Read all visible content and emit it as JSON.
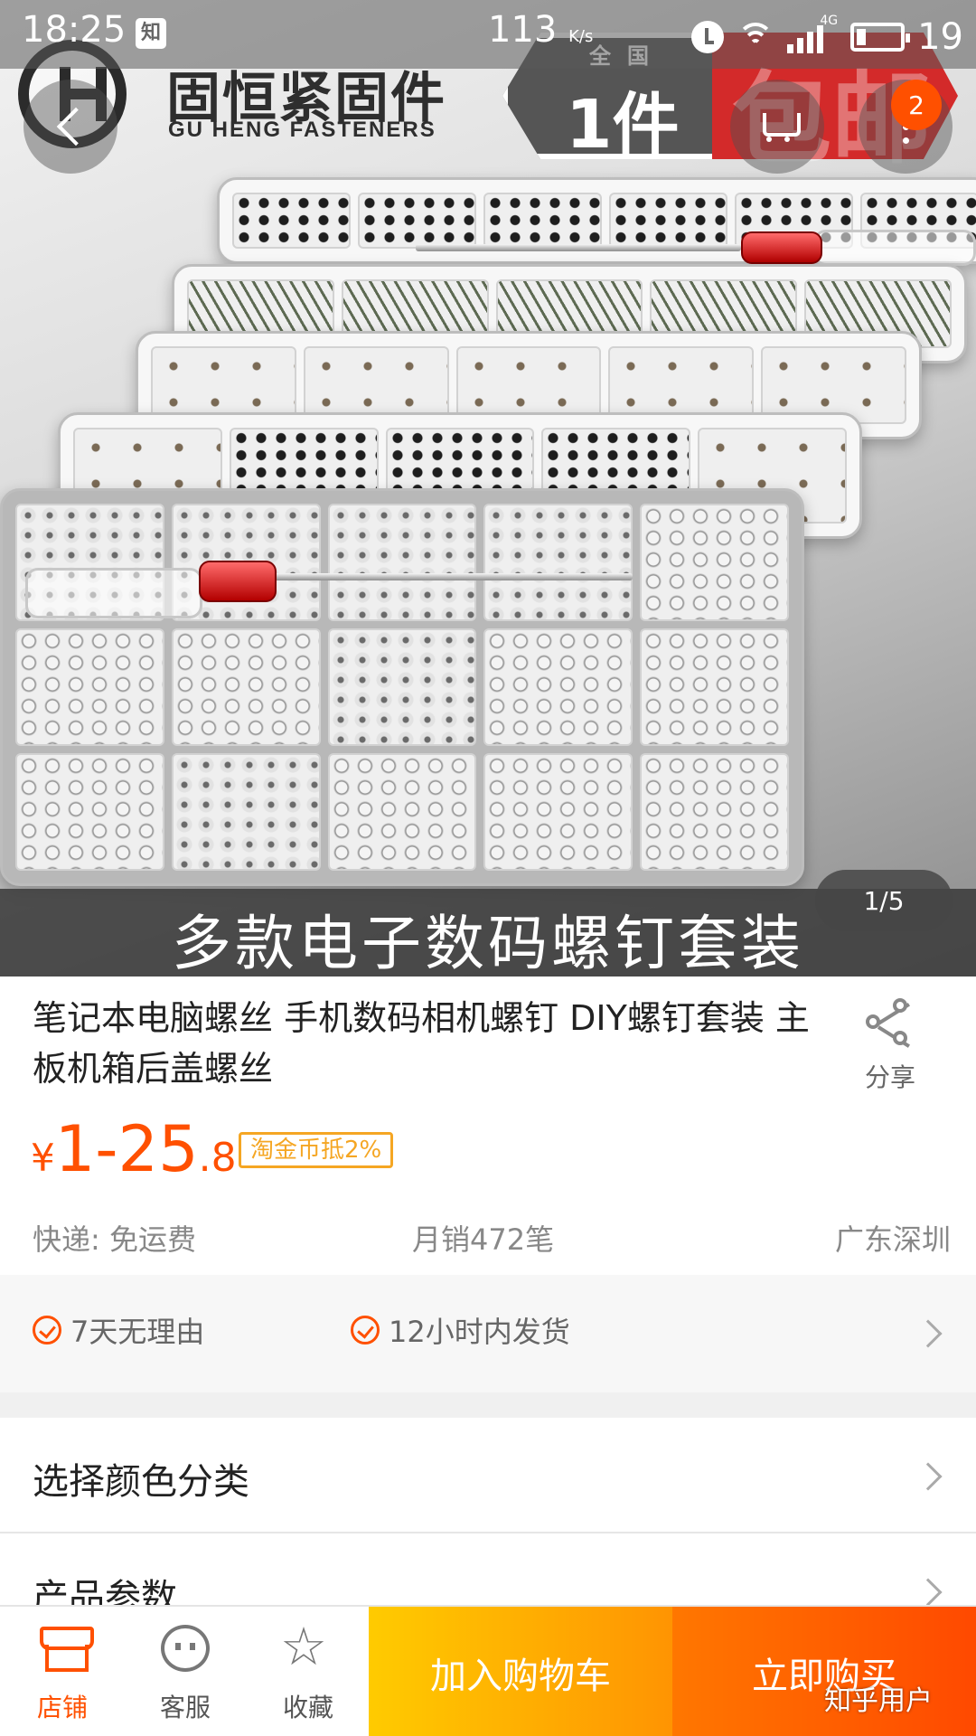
{
  "status_bar": {
    "time": "18:25",
    "notification_app": "知",
    "net_speed": "113",
    "net_speed_unit": "K/s",
    "network_type": "4G",
    "battery_level": "19"
  },
  "hero": {
    "brand_name_cn": "固恒紧固件",
    "brand_name_en": "GU HENG FASTENERS",
    "promo_top": "全国",
    "promo_main": "1件",
    "promo_red": "包邮",
    "caption": "多款电子数码螺钉套装",
    "page_indicator": "1/5"
  },
  "nav": {
    "cart_badge": "2",
    "icons": [
      "back-icon",
      "cart-icon",
      "more-icon"
    ]
  },
  "product": {
    "title": "笔记本电脑螺丝 手机数码相机螺钉 DIY螺钉套装 主板机箱后盖螺丝",
    "share_label": "分享",
    "price_symbol": "¥",
    "price_main": "1-25",
    "price_decimal": ".8",
    "coin_tag": "淘金币抵2%",
    "shipping": "快递: 免运费",
    "monthly_sales": "月销472笔",
    "location": "广东深圳"
  },
  "services": [
    {
      "label": "7天无理由"
    },
    {
      "label": "12小时内发货"
    }
  ],
  "options": [
    {
      "label": "选择颜色分类"
    },
    {
      "label": "产品参数"
    }
  ],
  "bottom_bar": {
    "store_label": "店铺",
    "service_label": "客服",
    "favorite_label": "收藏",
    "add_to_cart_label": "加入购物车",
    "buy_now_label": "立即购买"
  },
  "watermark": "知乎用户",
  "colors": {
    "accent": "#ff5000",
    "cart_gradient": [
      "#ffcb00",
      "#ff9402"
    ],
    "buy_gradient": [
      "#ff7700",
      "#ff4900"
    ],
    "coin_tag": "#f5a623"
  }
}
